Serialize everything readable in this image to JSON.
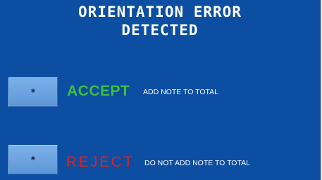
{
  "header": {
    "line1": "ORIENTATION ERROR",
    "line2": "DETECTED"
  },
  "options": {
    "accept": {
      "key_label": "*",
      "word": "ACCEPT",
      "description": "ADD NOTE TO TOTAL",
      "color": "#3fbf3f"
    },
    "reject": {
      "key_label": "*",
      "word": "REJECT",
      "description": "DO NOT ADD NOTE TO TOTAL",
      "color": "#e0221f"
    }
  },
  "colors": {
    "background": "#0b4ea2",
    "button": "#6ea5e3",
    "text": "#ffffff"
  }
}
